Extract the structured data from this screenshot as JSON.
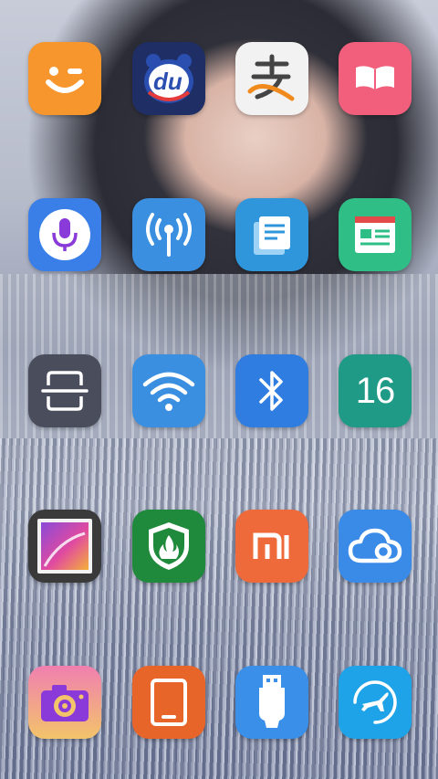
{
  "wallpaper": {
    "description_color_top": "#c8ccd9",
    "description_color_bottom": "#6f789a"
  },
  "apps": [
    {
      "name": "smiley-app",
      "icon": "smiley-icon",
      "bg": "#f7962c"
    },
    {
      "name": "baidu-du-app",
      "icon": "du-bear-icon",
      "label_text": "du",
      "bg": "#1f2f66"
    },
    {
      "name": "alipay-app",
      "icon": "alipay-icon",
      "bg": "#f2f2f2"
    },
    {
      "name": "ebook-app",
      "icon": "open-book-icon",
      "bg": "#f25f7c"
    },
    {
      "name": "voice-assistant-app",
      "icon": "microphone-icon",
      "bg": "#3a7ee8"
    },
    {
      "name": "hotspot-app",
      "icon": "antenna-icon",
      "bg": "#3a8fe0"
    },
    {
      "name": "notes-app",
      "icon": "documents-icon",
      "bg": "#2f96dc"
    },
    {
      "name": "news-app",
      "icon": "newspaper-icon",
      "bg": "#2fbf86"
    },
    {
      "name": "scanner-app",
      "icon": "scan-icon",
      "bg": "#4a4d5c"
    },
    {
      "name": "wifi-app",
      "icon": "wifi-icon",
      "bg": "#3a8fe0"
    },
    {
      "name": "bluetooth-app",
      "icon": "bluetooth-icon",
      "bg": "#2f7de0"
    },
    {
      "name": "calendar-app",
      "icon": "calendar-icon",
      "label_text": "16",
      "bg": "#1f9a86"
    },
    {
      "name": "gallery-app",
      "icon": "gallery-icon",
      "bg": "#3a3a3a"
    },
    {
      "name": "security-app",
      "icon": "shield-fire-icon",
      "bg": "#1f8a3c"
    },
    {
      "name": "mi-store-app",
      "icon": "mi-logo-icon",
      "bg": "#ef6a3a"
    },
    {
      "name": "cloud-app",
      "icon": "cloud-icon",
      "bg": "#3a8be8"
    },
    {
      "name": "camera-app",
      "icon": "camera-icon",
      "bg": "#f07fb0"
    },
    {
      "name": "reader-app",
      "icon": "tablet-icon",
      "bg": "#e8652a"
    },
    {
      "name": "usb-app",
      "icon": "usb-icon",
      "bg": "#3a8fe8"
    },
    {
      "name": "flight-app",
      "icon": "airplane-icon",
      "bg": "#1fa3e8"
    }
  ]
}
